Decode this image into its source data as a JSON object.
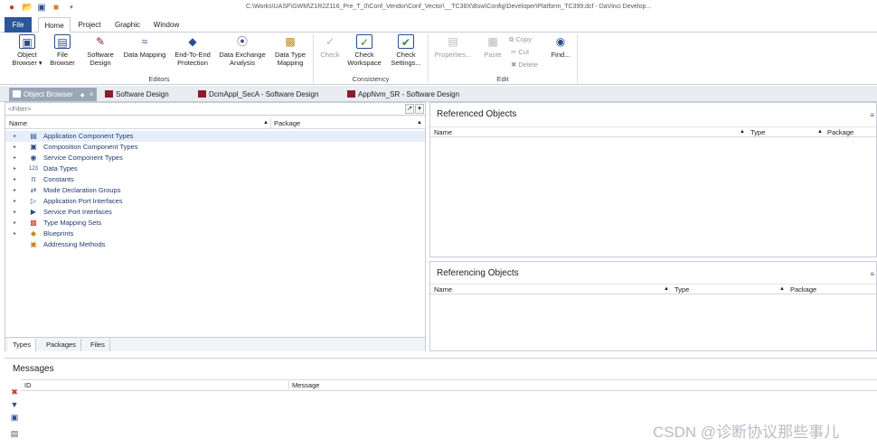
{
  "title_bar": {
    "title": "C:\\Works\\UASF\\GWM\\Z1R2Z116_Pre_T_0\\Conf_Vendor\\Conf_Vector\\__TC38X\\Bsw\\Config\\Developer\\Platform_TC399.dcf - DaVinci Develop..."
  },
  "ribbon_tabs": [
    "File",
    "Home",
    "Project",
    "Graphic",
    "Window"
  ],
  "ribbon": {
    "editors_group": "Editors",
    "consistency_group": "Consistency",
    "edit_group": "Edit",
    "buttons": {
      "object_browser": [
        "Object",
        "Browser ▾"
      ],
      "file_browser": [
        "File",
        "Browser"
      ],
      "software_design": [
        "Software",
        "Design"
      ],
      "data_mapping": [
        "Data Mapping",
        ""
      ],
      "end_to_end": [
        "End-To-End",
        "Protection"
      ],
      "data_exchange": [
        "Data Exchange",
        "Analysis"
      ],
      "data_type_mapping": [
        "Data Type",
        "Mapping"
      ],
      "check": [
        "Check",
        ""
      ],
      "check_workspace": [
        "Check",
        "Workspace"
      ],
      "check_settings": [
        "Check",
        "Settings..."
      ],
      "properties": [
        "Properties...",
        ""
      ],
      "paste": [
        "Paste",
        ""
      ],
      "copy": "Copy",
      "cut": "Cut",
      "delete": "Delete",
      "find": [
        "Find...",
        ""
      ]
    }
  },
  "doc_tabs": [
    "Object Browser",
    "Software Design",
    "DcmAppl_SecA - Software Design",
    "AppNvm_SR - Software Design"
  ],
  "object_browser": {
    "filter_placeholder": "<Filter>",
    "col_name": "Name",
    "col_package": "Package",
    "items": [
      "Application Component Types",
      "Composition Component Types",
      "Service Component Types",
      "Data Types",
      "Constants",
      "Mode Declaration Groups",
      "Application Port Interfaces",
      "Service Port Interfaces",
      "Type Mapping Sets",
      "Blueprints",
      "Addressing Methods"
    ],
    "bottom_tabs": [
      "Types",
      "Packages",
      "Files"
    ]
  },
  "referenced_objects": {
    "title": "Referenced Objects",
    "col_name": "Name",
    "col_type": "Type",
    "col_package": "Package"
  },
  "referencing_objects": {
    "title": "Referencing Objects",
    "col_name": "Name",
    "col_type": "Type",
    "col_package": "Package"
  },
  "messages": {
    "title": "Messages",
    "col_id": "ID",
    "col_message": "Message"
  },
  "watermark": "CSDN @诊断协议那些事儿",
  "colors": {
    "file_tab": "#2b579a",
    "active_doc_tab": "#9aa7b9",
    "tree_text": "#1f3b6e",
    "selection": "#e6eef9"
  }
}
